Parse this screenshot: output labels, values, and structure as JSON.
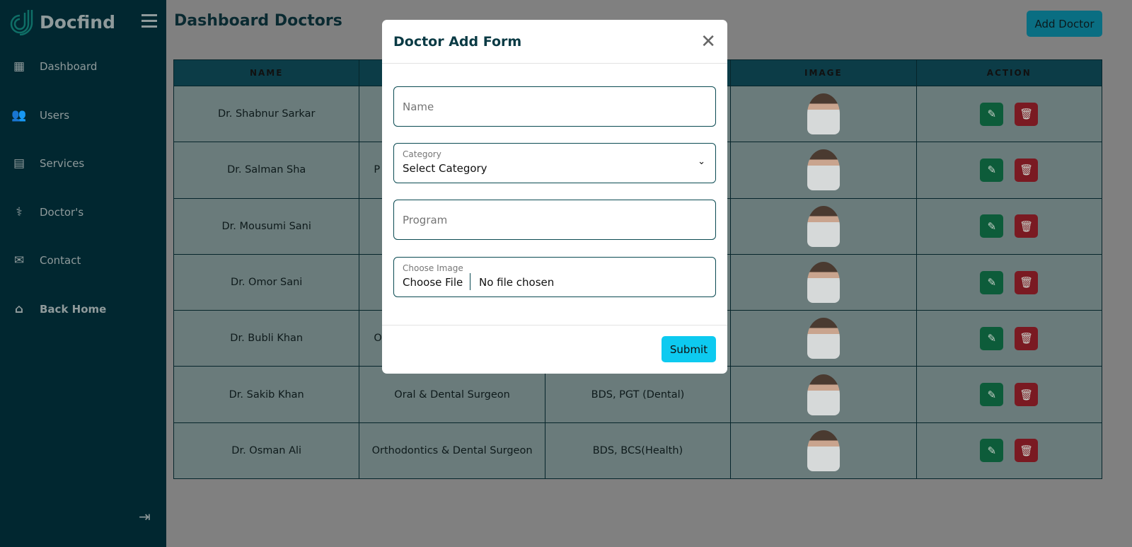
{
  "sidebar": {
    "brand": "Docfind",
    "items": [
      {
        "label": "Dashboard",
        "icon": "grid-icon"
      },
      {
        "label": "Users",
        "icon": "users-icon"
      },
      {
        "label": "Services",
        "icon": "server-icon"
      },
      {
        "label": "Doctor's",
        "icon": "stethoscope-icon"
      },
      {
        "label": "Contact",
        "icon": "envelope-icon"
      },
      {
        "label": "Back Home",
        "icon": "home-icon"
      }
    ]
  },
  "header": {
    "title": "Dashboard Doctors",
    "add_button": "Add Doctor"
  },
  "table": {
    "columns": [
      "NAME",
      "",
      "",
      "IMAGE",
      "ACTION"
    ],
    "rows": [
      {
        "name": "Dr. Shabnur Sarkar",
        "category": "",
        "program": ""
      },
      {
        "name": "Dr. Salman Sha",
        "category": "P",
        "program": ""
      },
      {
        "name": "Dr. Mousumi Sani",
        "category": "",
        "program": ""
      },
      {
        "name": "Dr. Omor Sani",
        "category": "",
        "program": ""
      },
      {
        "name": "Dr. Bubli Khan",
        "category": "Or",
        "program": ""
      },
      {
        "name": "Dr. Sakib Khan",
        "category": "Oral & Dental Surgeon",
        "program": "BDS, PGT (Dental)"
      },
      {
        "name": "Dr. Osman Ali",
        "category": "Orthodontics & Dental Surgeon",
        "program": "BDS, BCS(Health)"
      }
    ]
  },
  "modal": {
    "title": "Doctor Add Form",
    "name_placeholder": "Name",
    "category_label": "Category",
    "category_value": "Select Category",
    "program_placeholder": "Program",
    "image_label": "Choose Image",
    "choose_file": "Choose File",
    "no_file": "No file chosen",
    "submit": "Submit"
  },
  "colors": {
    "sidebar": "#012730",
    "table_header": "#0c3c47",
    "edit": "#0d5c3a",
    "delete": "#7a1a22",
    "submit": "#0dcaf0"
  }
}
